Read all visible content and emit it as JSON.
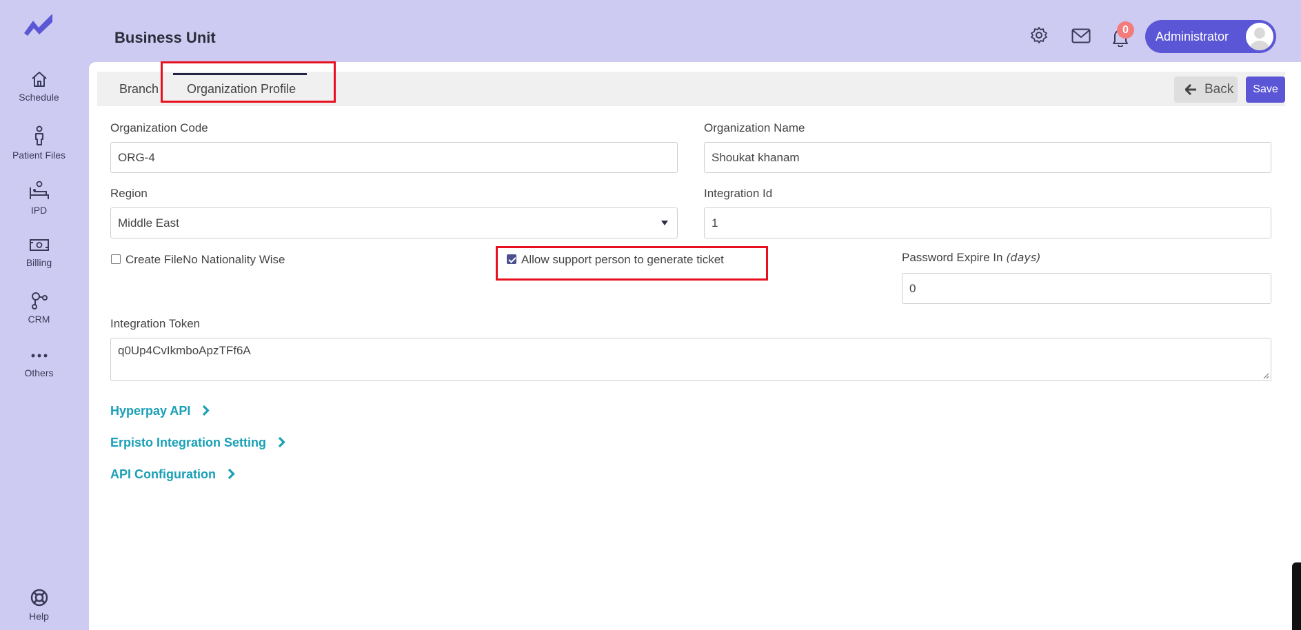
{
  "header": {
    "title": "Business Unit",
    "notification_count": "0",
    "user_name": "Administrator"
  },
  "sidebar": {
    "items": [
      {
        "label": "Schedule",
        "icon": "home-icon"
      },
      {
        "label": "Patient Files",
        "icon": "person-icon"
      },
      {
        "label": "IPD",
        "icon": "bed-icon"
      },
      {
        "label": "Billing",
        "icon": "money-icon"
      },
      {
        "label": "CRM",
        "icon": "network-icon"
      },
      {
        "label": "Others",
        "icon": "more-icon"
      }
    ],
    "help_label": "Help"
  },
  "tabs": [
    {
      "label": "Branch",
      "active": false
    },
    {
      "label": "Organization Profile",
      "active": true
    }
  ],
  "actions": {
    "back_label": "Back",
    "save_label": "Save"
  },
  "form": {
    "org_code_label": "Organization Code",
    "org_code_value": "ORG-4",
    "org_name_label": "Organization Name",
    "org_name_value": "Shoukat khanam",
    "region_label": "Region",
    "region_value": "Middle East",
    "integration_id_label": "Integration Id",
    "integration_id_value": "1",
    "create_fileno_label": "Create FileNo Nationality Wise",
    "create_fileno_checked": false,
    "allow_support_label": "Allow support person to generate ticket",
    "allow_support_checked": true,
    "password_expire_label": "Password Expire In ",
    "password_expire_unit": "(days)",
    "password_expire_value": "0",
    "integration_token_label": "Integration Token",
    "integration_token_value": "q0Up4CvIkmboApzTFf6A"
  },
  "links": [
    {
      "label": "Hyperpay API"
    },
    {
      "label": "Erpisto Integration Setting"
    },
    {
      "label": "API Configuration"
    }
  ],
  "colors": {
    "background": "#cdcbf1",
    "accent": "#5b56d6",
    "link": "#18a0b6",
    "highlight": "#e8101e",
    "badge": "#f37b7b"
  }
}
